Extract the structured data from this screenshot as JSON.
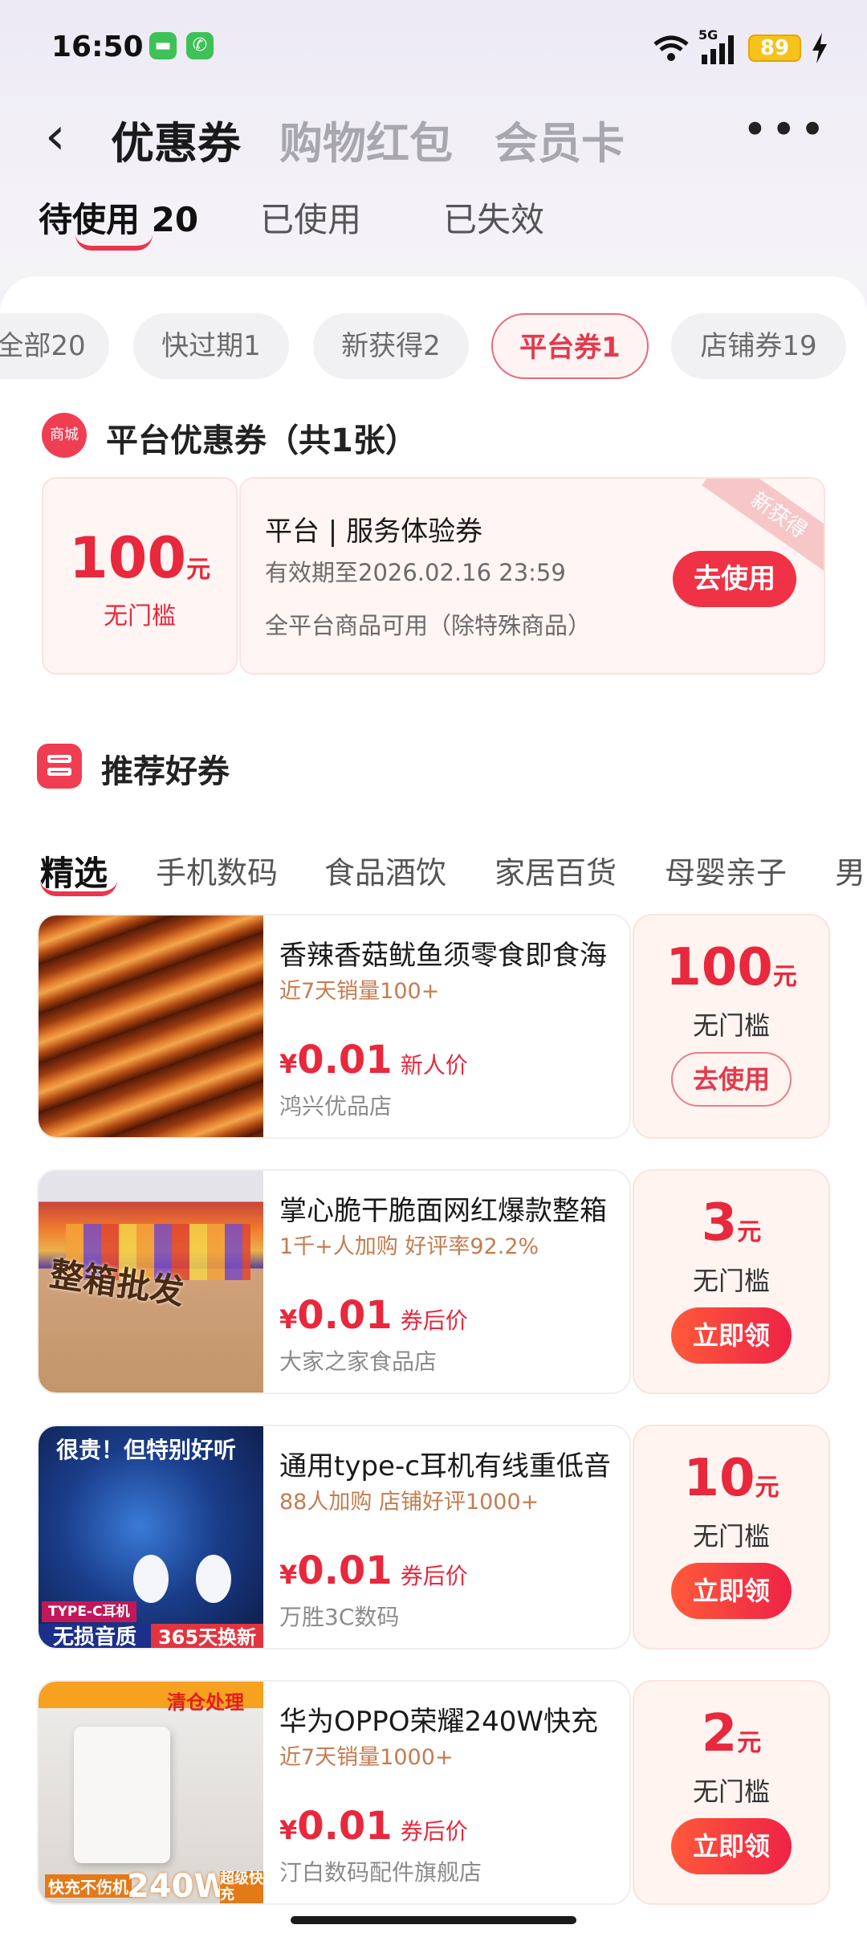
{
  "status": {
    "time": "16:50",
    "network": "5G",
    "battery": "89"
  },
  "header": {
    "tabs": [
      "优惠券",
      "购物红包",
      "会员卡"
    ],
    "more": "•••"
  },
  "subtabs": [
    "待使用 20",
    "已使用",
    "已失效"
  ],
  "chips": [
    "全部20",
    "快过期1",
    "新获得2",
    "平台券1",
    "店铺券19"
  ],
  "platform_section": {
    "icon_label": "商城",
    "title": "平台优惠券（共1张）",
    "coupon": {
      "amount": "100",
      "unit": "元",
      "condition": "无门槛",
      "name": "平台 | 服务体验券",
      "validity": "有效期至2026.02.16 23:59",
      "scope": "全平台商品可用（除特殊商品）",
      "button": "去使用",
      "ribbon": "新获得"
    }
  },
  "recommend": {
    "title": "推荐好券",
    "categories": [
      "精选",
      "手机数码",
      "食品酒饮",
      "家居百货",
      "母婴亲子",
      "男"
    ],
    "items": [
      {
        "name": "香辣香菇鱿鱼须零食即食海",
        "sub": "近7天销量100+",
        "price_sym": "¥",
        "price": "0.01",
        "price_tag": "新人价",
        "shop": "鸿兴优品店",
        "coupon_amount": "100",
        "coupon_unit": "元",
        "coupon_cond": "无门槛",
        "button": "去使用"
      },
      {
        "name": "掌心脆干脆面网红爆款整箱",
        "sub": "1千+人加购  好评率92.2%",
        "price_sym": "¥",
        "price": "0.01",
        "price_tag": "券后价",
        "shop": "大家之家食品店",
        "coupon_amount": "3",
        "coupon_unit": "元",
        "coupon_cond": "无门槛",
        "button": "立即领",
        "thumb_text": "整箱批发"
      },
      {
        "name": "通用type-c耳机有线重低音",
        "sub": "88人加购  店铺好评1000+",
        "price_sym": "¥",
        "price": "0.01",
        "price_tag": "券后价",
        "shop": "万胜3C数码",
        "coupon_amount": "10",
        "coupon_unit": "元",
        "coupon_cond": "无门槛",
        "button": "立即领",
        "thumb_top": "很贵！但特别好听",
        "thumb_badge": "TYPE-C耳机",
        "thumb_bottom_left": "无损音质",
        "thumb_bottom_right": "365天换新"
      },
      {
        "name": "华为OPPO荣耀240W快充",
        "sub": "近7天销量1000+",
        "price_sym": "¥",
        "price": "0.01",
        "price_tag": "券后价",
        "shop": "汀白数码配件旗舰店",
        "coupon_amount": "2",
        "coupon_unit": "元",
        "coupon_cond": "无门槛",
        "button": "立即领",
        "thumb_top": "清仓处理",
        "thumb_bottom": "快充不伤机",
        "thumb_watt": "240W",
        "thumb_tag": "超级快充"
      }
    ]
  }
}
